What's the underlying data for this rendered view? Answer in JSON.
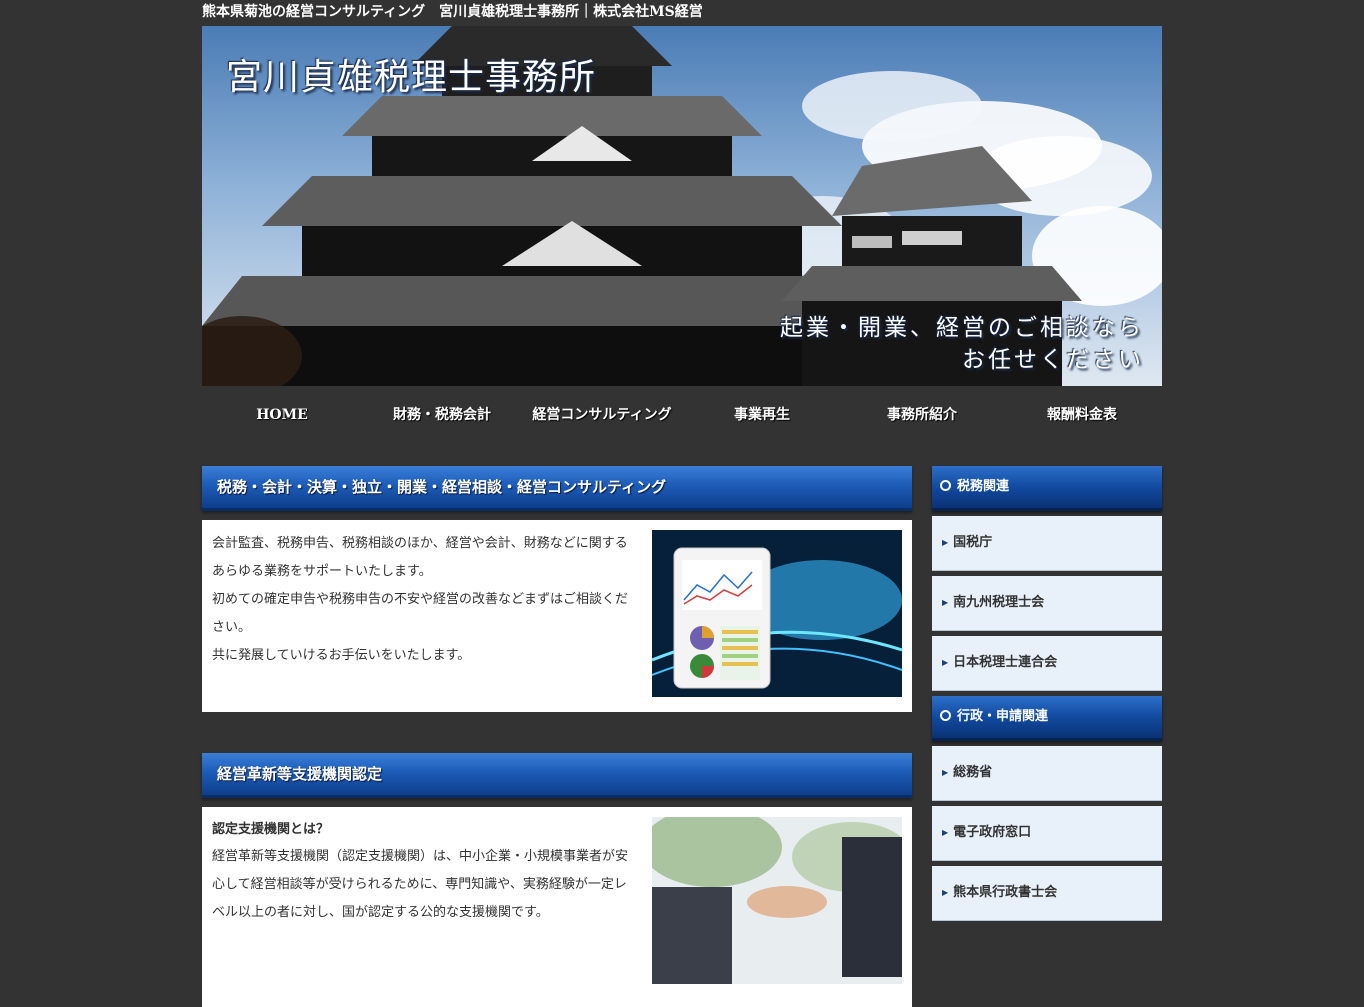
{
  "header": {
    "topline": "熊本県菊池の経営コンサルティング　宮川貞雄税理士事務所｜株式会社MS経営",
    "hero_title": "宮川貞雄税理士事務所",
    "hero_tagline_1": "起業・開業、経営のご相談なら",
    "hero_tagline_2": "お任せください"
  },
  "nav": {
    "items": [
      {
        "label": "HOME"
      },
      {
        "label": "財務・税務会計"
      },
      {
        "label": "経営コンサルティング"
      },
      {
        "label": "事業再生"
      },
      {
        "label": "事務所紹介"
      },
      {
        "label": "報酬料金表"
      }
    ]
  },
  "main": {
    "section1": {
      "heading": "税務・会計・決算・独立・開業・経営相談・経営コンサルティング",
      "paragraphs": [
        "会計監査、税務申告、税務相談のほか、経営や会計、財務などに関するあらゆる業務をサポートいたします。",
        "初めての確定申告や税務申告の不安や経営の改善などまずはご相談ください。",
        "共に発展していけるお手伝いをいたします。"
      ]
    },
    "section2": {
      "heading": "経営革新等支援機関認定",
      "subheading": "認定支援機関とは？",
      "paragraph": "経営革新等支援機関（認定支援機関）は、中小企業・小規模事業者が安心して経営相談等が受けられるために、専門知識や、実務経験が一定レベル以上の者に対し、国が認定する公的な支援機関です。"
    }
  },
  "sidebar": {
    "group1": {
      "title": "税務関連",
      "items": [
        {
          "label": "国税庁"
        },
        {
          "label": "南九州税理士会"
        },
        {
          "label": "日本税理士連合会"
        }
      ]
    },
    "group2": {
      "title": "行政・申請関連",
      "items": [
        {
          "label": "総務省"
        },
        {
          "label": "電子政府窓口"
        },
        {
          "label": "熊本県行政書士会"
        }
      ]
    }
  },
  "colors": {
    "background": "#333333",
    "heading_blue": "#1d5cb8",
    "sidebar_item_bg": "#e8f0fa"
  }
}
